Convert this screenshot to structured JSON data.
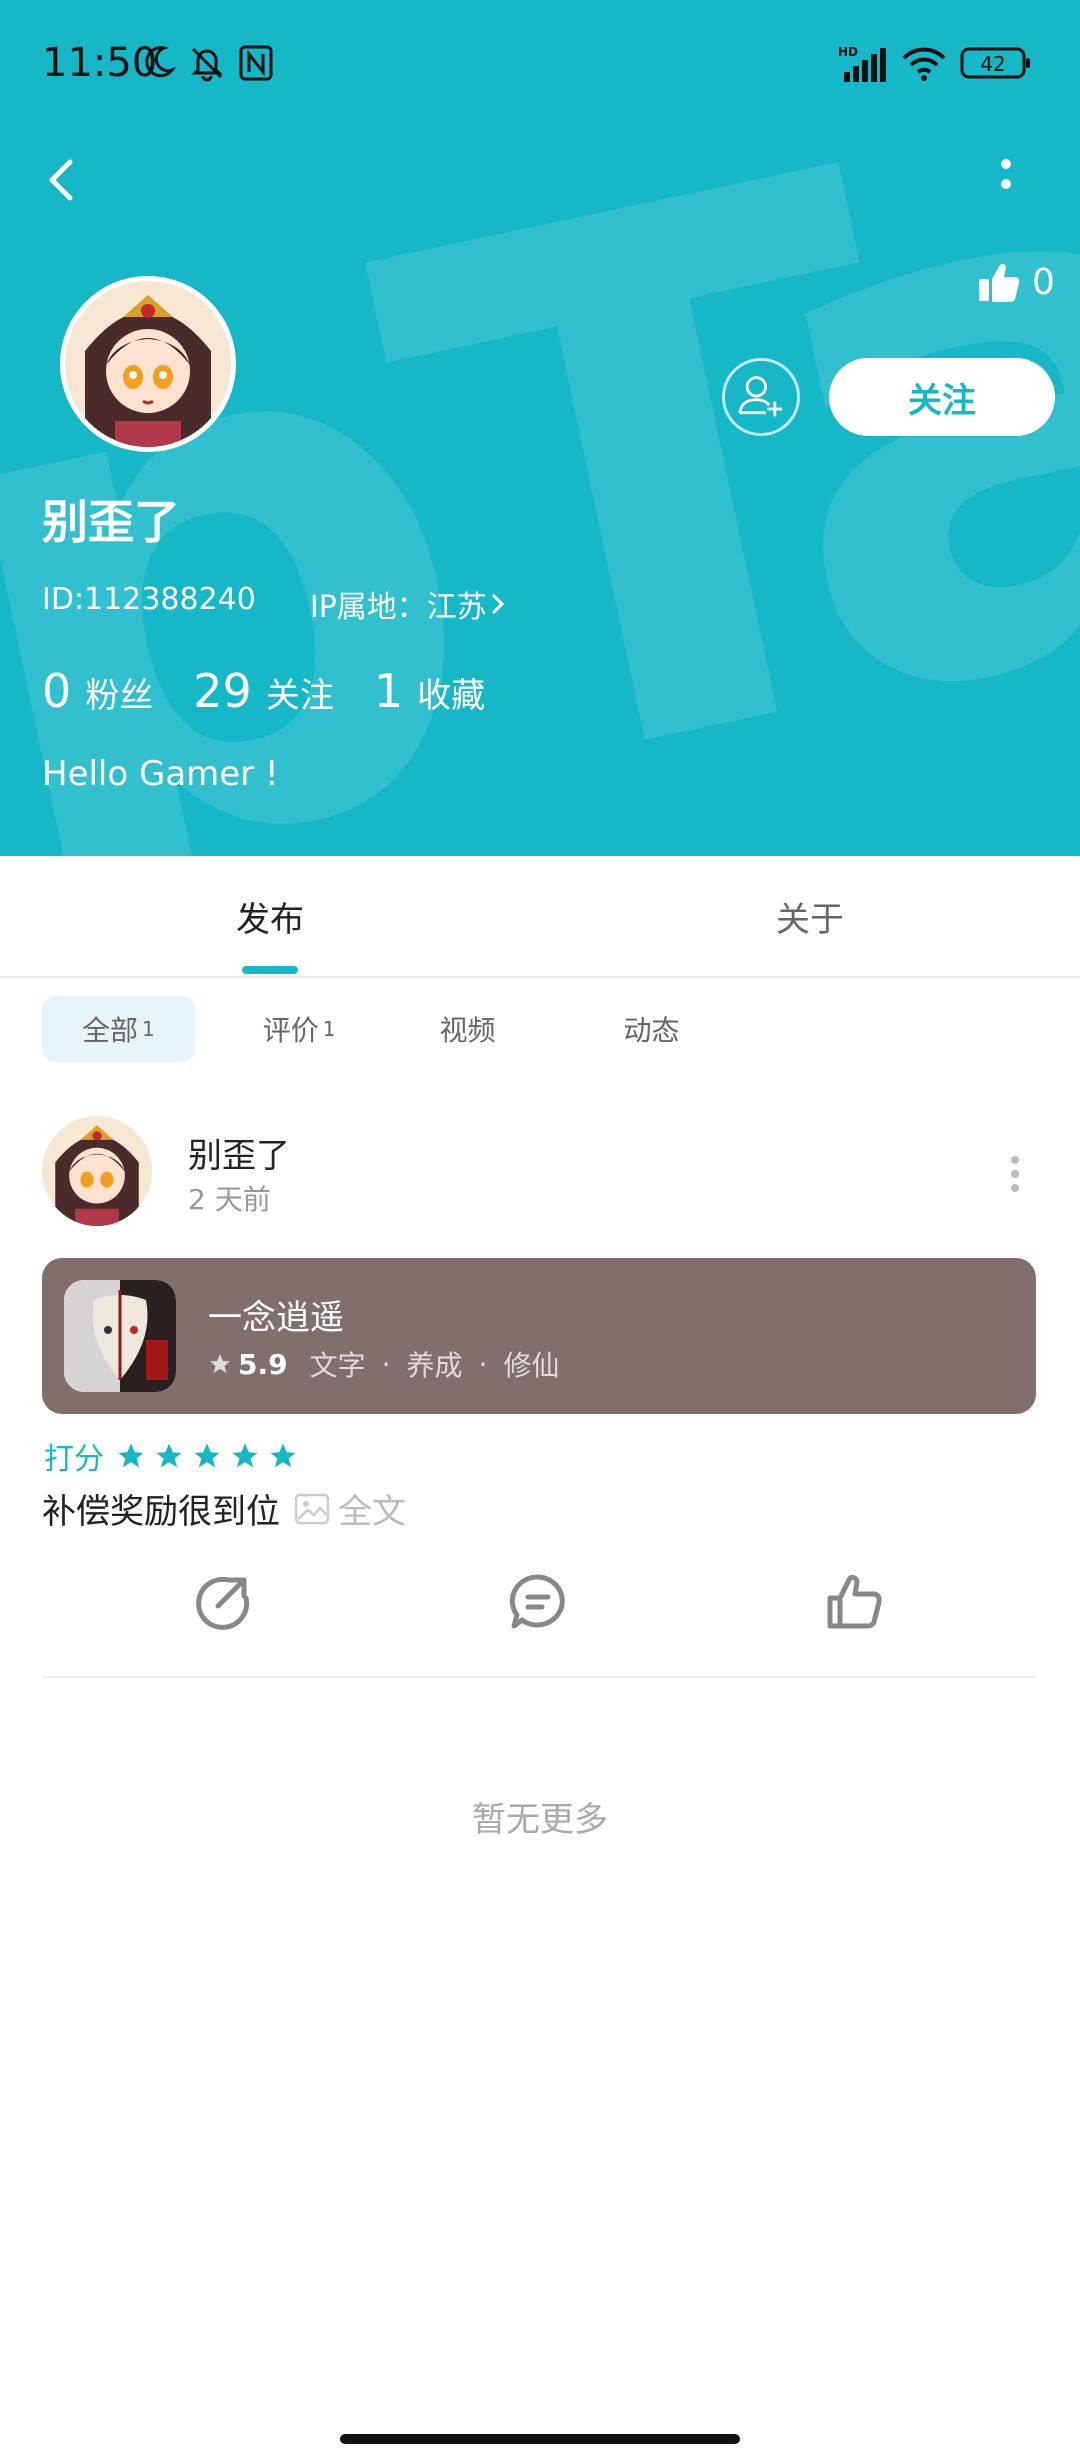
{
  "status_bar": {
    "time": "11:50",
    "battery": "42",
    "network_label": "HD"
  },
  "header": {
    "like_count": "0",
    "follow_label": "关注"
  },
  "profile": {
    "name": "别歪了",
    "id_text": "ID:112388240",
    "ip_text": "IP属地：江苏",
    "stats": [
      {
        "num": "0",
        "label": "粉丝"
      },
      {
        "num": "29",
        "label": "关注"
      },
      {
        "num": "1",
        "label": "收藏"
      }
    ],
    "bio": "Hello Gamer !"
  },
  "tabs": {
    "publish": "发布",
    "about": "关于"
  },
  "filters": [
    {
      "label": "全部",
      "count": "1"
    },
    {
      "label": "评价",
      "count": "1"
    },
    {
      "label": "视频",
      "count": ""
    },
    {
      "label": "动态",
      "count": ""
    }
  ],
  "post": {
    "author": "别歪了",
    "time": "2 天前",
    "game": {
      "name": "一念逍遥",
      "score": "5.9",
      "tags": [
        "文字",
        "养成",
        "修仙"
      ]
    },
    "rating_label": "打分",
    "stars": 5,
    "text": "补偿奖励很到位",
    "full_text_label": "全文"
  },
  "footer": {
    "no_more": "暂无更多"
  },
  "colors": {
    "accent": "#16b8c8",
    "card_bg": "#816f6e"
  }
}
